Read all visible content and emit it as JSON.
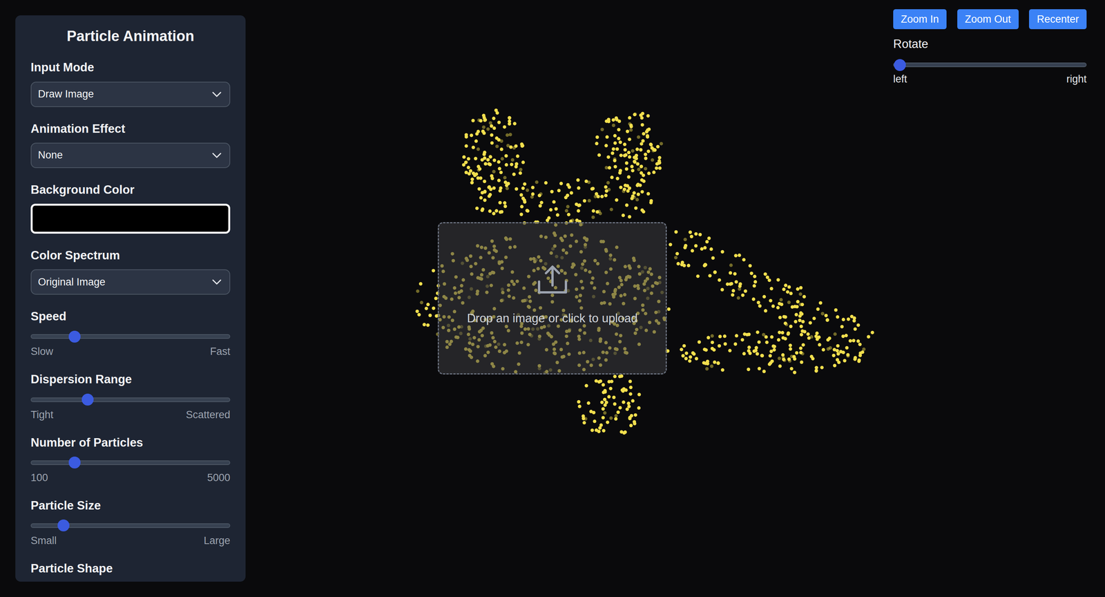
{
  "panel": {
    "title": "Particle Animation"
  },
  "controls": [
    {
      "kind": "select",
      "label": "Input Mode",
      "value": "Draw Image"
    },
    {
      "kind": "select",
      "label": "Animation Effect",
      "value": "None"
    },
    {
      "kind": "color",
      "label": "Background Color",
      "color": "#000000"
    },
    {
      "kind": "select",
      "label": "Color Spectrum",
      "value": "Original Image"
    },
    {
      "kind": "slider",
      "label": "Speed",
      "level": 0.2,
      "min_label": "Slow",
      "max_label": "Fast"
    },
    {
      "kind": "slider",
      "label": "Dispersion Range",
      "level": 0.27,
      "min_label": "Tight",
      "max_label": "Scattered"
    },
    {
      "kind": "slider",
      "label": "Number of Particles",
      "level": 0.2,
      "min_label": "100",
      "max_label": "5000"
    },
    {
      "kind": "slider",
      "label": "Particle Size",
      "level": 0.14,
      "min_label": "Small",
      "max_label": "Large"
    },
    {
      "kind": "heading",
      "label": "Particle Shape"
    }
  ],
  "view_buttons": [
    "Zoom In",
    "Zoom Out",
    "Recenter"
  ],
  "rotate": {
    "label": "Rotate",
    "level": 0,
    "min_label": "left",
    "max_label": "right"
  },
  "upload": {
    "text": "Drop an image or click to upload"
  }
}
